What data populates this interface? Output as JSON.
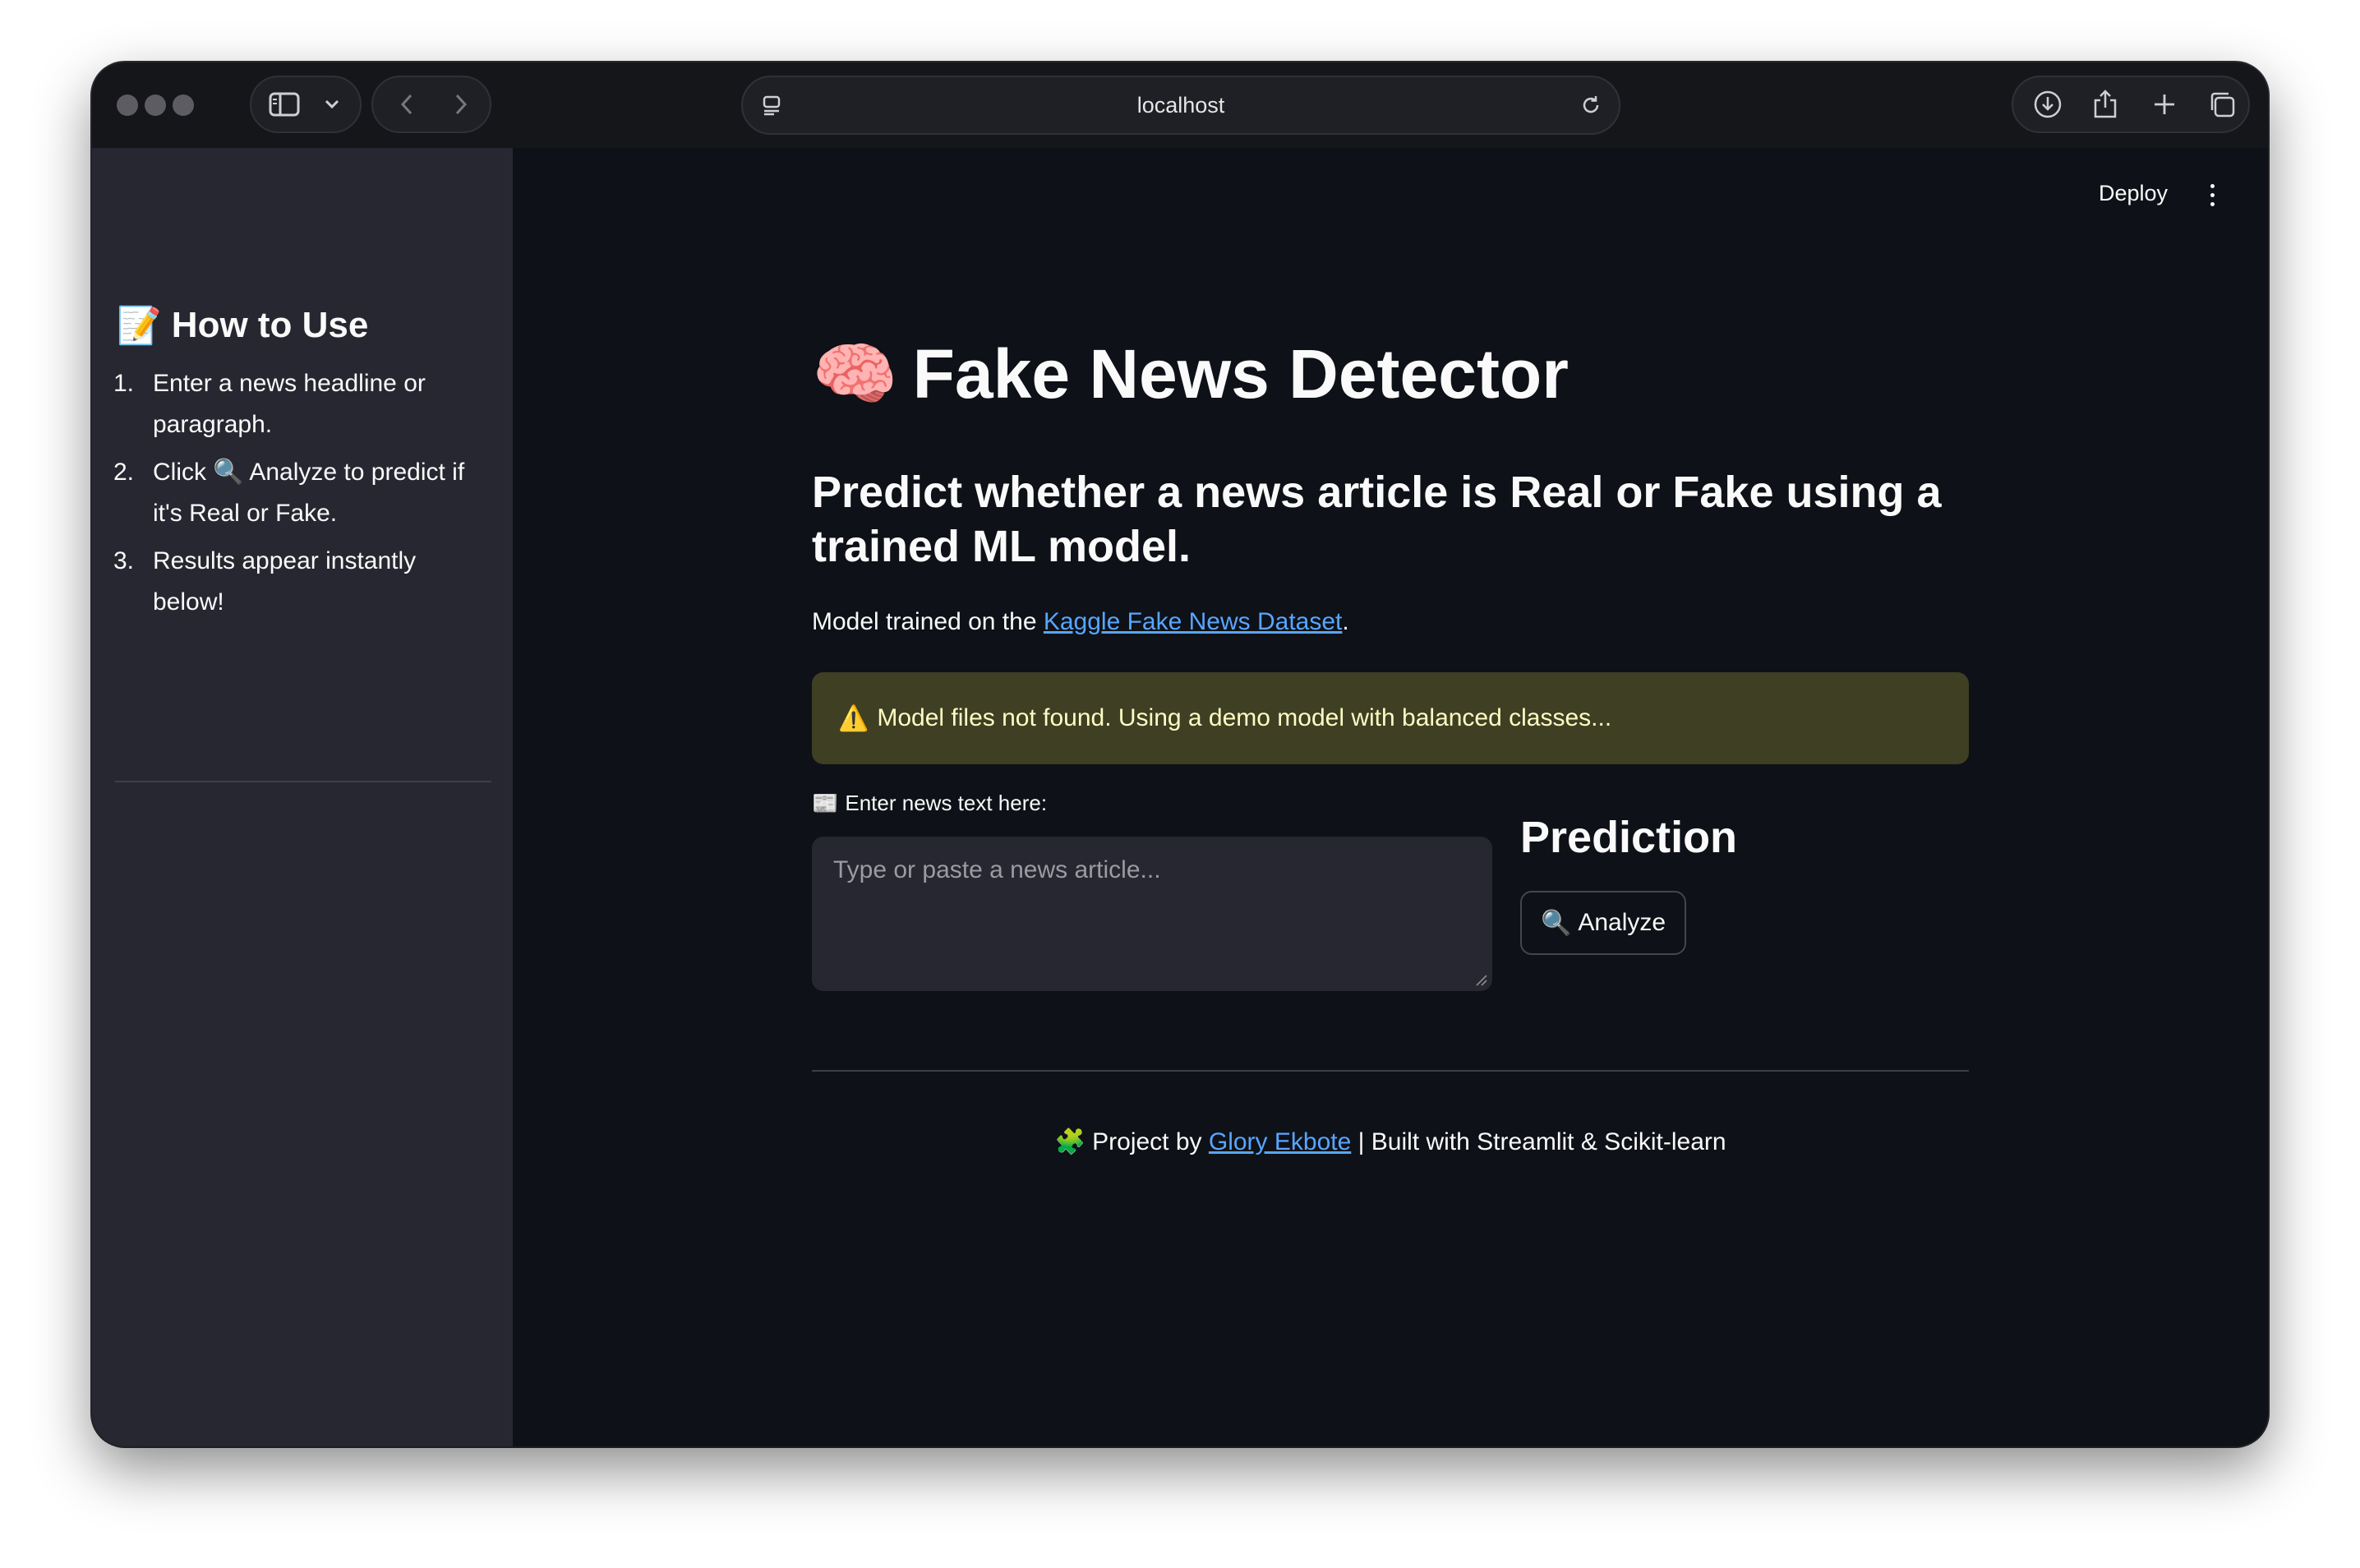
{
  "browser": {
    "url": "localhost"
  },
  "app": {
    "deploy_label": "Deploy"
  },
  "sidebar": {
    "title_emoji": "📝",
    "title": "How to Use",
    "steps": [
      {
        "num": "1.",
        "text": "Enter a news headline or paragraph."
      },
      {
        "num": "2.",
        "text": "Click 🔍 Analyze to predict if it's Real or Fake."
      },
      {
        "num": "3.",
        "text": "Results appear instantly below!"
      }
    ]
  },
  "main": {
    "title_emoji": "🧠",
    "title": "Fake News Detector",
    "subtitle": "Predict whether a news article is Real or Fake using a trained ML model.",
    "model_info_prefix": "Model trained on the",
    "model_info_link": "Kaggle Fake News Dataset",
    "model_info_suffix": ".",
    "warning_icon": "⚠️",
    "warning": "Model files not found. Using a demo model with balanced classes...",
    "input_label_emoji": "📰",
    "input_label": "Enter news text here:",
    "input_placeholder": "Type or paste a news article...",
    "input_value": "",
    "prediction_heading": "Prediction",
    "analyze_icon": "🔍",
    "analyze_label": "Analyze"
  },
  "footer": {
    "emoji": "🧩",
    "prefix": "Project by",
    "author": "Glory Ekbote",
    "suffix": "| Built with Streamlit & Scikit-learn"
  },
  "colors": {
    "background": "#0e1117",
    "sidebar": "#262730",
    "link": "#58a6ff",
    "warning_bg": "#3e3f23",
    "warning_text": "#fdfdc3"
  }
}
